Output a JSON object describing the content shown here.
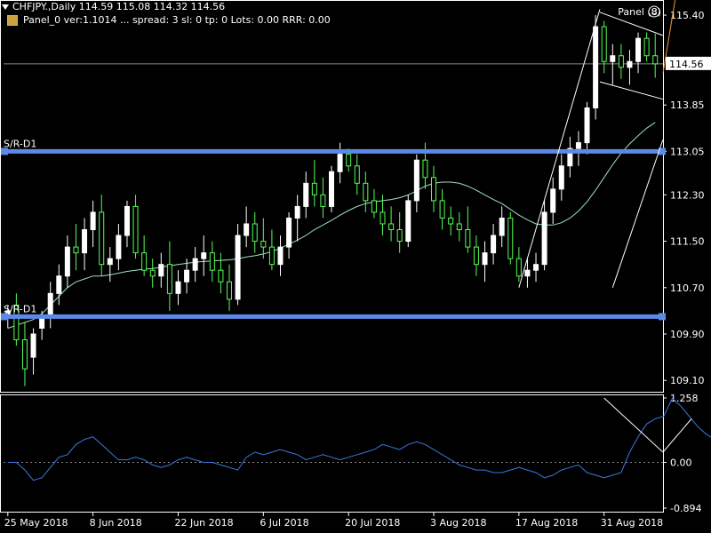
{
  "header": {
    "symbol_line": "CHFJPY.,Daily  114.59 115.08 114.32 114.56",
    "panel_line": "Panel_0 ver:1.1014 ... spread: 3   sl: 0   tp: 0   Lots: 0.00   RRR: 0.00",
    "panel_button": "Panel (8)"
  },
  "labels": {
    "sr_upper": "S/R-D1",
    "sr_lower": "S/R-D1"
  },
  "colors": {
    "background": "#000000",
    "bull": "#ffffff",
    "bear": "#55ff55",
    "sr_line": "#5b8ae8",
    "ma_line": "#9fe0c4",
    "oscillator": "#3b78e0",
    "trend_line": "#ffffff",
    "orange_line": "#f0a030",
    "price_tag_bg": "#ffffff",
    "price_tag_text": "#000000"
  },
  "chart_data": [
    {
      "type": "candlestick",
      "x_labels": [
        "25 May 2018",
        "8 Jun 2018",
        "22 Jun 2018",
        "6 Jul 2018",
        "20 Jul 2018",
        "3 Aug 2018",
        "17 Aug 2018",
        "31 Aug 2018"
      ],
      "y_ticks": [
        "115.40",
        "114.56",
        "113.85",
        "113.05",
        "112.30",
        "111.50",
        "110.70",
        "109.90",
        "109.10"
      ],
      "y_tick_values": [
        115.4,
        114.56,
        113.85,
        113.05,
        112.3,
        111.5,
        110.7,
        109.9,
        109.1
      ],
      "ylim": [
        108.95,
        115.6
      ],
      "current_price": "114.56",
      "support_resistance": [
        113.05,
        110.2
      ],
      "candles": [
        [
          110.2,
          110.4,
          110.0,
          110.3
        ],
        [
          110.4,
          110.6,
          109.7,
          109.8
        ],
        [
          109.8,
          110.1,
          109.0,
          109.3
        ],
        [
          109.5,
          110.0,
          109.2,
          109.9
        ],
        [
          110.0,
          110.3,
          109.8,
          110.2
        ],
        [
          110.2,
          110.8,
          110.0,
          110.6
        ],
        [
          110.6,
          111.1,
          110.4,
          110.9
        ],
        [
          110.9,
          111.6,
          110.7,
          111.4
        ],
        [
          111.4,
          111.8,
          111.0,
          111.3
        ],
        [
          111.3,
          111.9,
          111.0,
          111.7
        ],
        [
          111.7,
          112.2,
          111.4,
          112.0
        ],
        [
          112.0,
          112.3,
          110.9,
          111.1
        ],
        [
          111.1,
          111.4,
          110.8,
          111.2
        ],
        [
          111.2,
          111.8,
          111.0,
          111.6
        ],
        [
          111.6,
          112.2,
          111.4,
          112.1
        ],
        [
          112.1,
          112.3,
          111.2,
          111.3
        ],
        [
          111.3,
          111.6,
          110.9,
          111.0
        ],
        [
          111.0,
          111.2,
          110.7,
          110.9
        ],
        [
          110.9,
          111.3,
          110.7,
          111.1
        ],
        [
          111.1,
          111.5,
          110.3,
          110.6
        ],
        [
          110.6,
          111.0,
          110.4,
          110.8
        ],
        [
          110.8,
          111.2,
          110.6,
          111.0
        ],
        [
          111.0,
          111.4,
          110.8,
          111.2
        ],
        [
          111.2,
          111.6,
          110.9,
          111.3
        ],
        [
          111.3,
          111.5,
          110.8,
          111.0
        ],
        [
          111.0,
          111.3,
          110.6,
          110.8
        ],
        [
          110.8,
          111.1,
          110.3,
          110.5
        ],
        [
          110.5,
          111.8,
          110.4,
          111.6
        ],
        [
          111.6,
          112.1,
          111.4,
          111.8
        ],
        [
          111.8,
          112.0,
          111.3,
          111.5
        ],
        [
          111.5,
          111.9,
          111.2,
          111.4
        ],
        [
          111.4,
          111.7,
          111.0,
          111.1
        ],
        [
          111.1,
          111.6,
          110.9,
          111.4
        ],
        [
          111.4,
          112.0,
          111.2,
          111.9
        ],
        [
          111.9,
          112.3,
          111.5,
          112.1
        ],
        [
          112.1,
          112.7,
          111.9,
          112.5
        ],
        [
          112.5,
          112.9,
          112.1,
          112.3
        ],
        [
          112.3,
          112.6,
          111.9,
          112.1
        ],
        [
          112.1,
          112.8,
          112.0,
          112.7
        ],
        [
          112.7,
          113.2,
          112.5,
          113.0
        ],
        [
          113.0,
          113.1,
          112.7,
          112.8
        ],
        [
          112.8,
          113.0,
          112.3,
          112.5
        ],
        [
          112.5,
          112.7,
          112.0,
          112.2
        ],
        [
          112.2,
          112.4,
          111.9,
          112.0
        ],
        [
          112.0,
          112.3,
          111.6,
          111.8
        ],
        [
          111.8,
          112.1,
          111.5,
          111.7
        ],
        [
          111.7,
          112.0,
          111.3,
          111.5
        ],
        [
          111.5,
          112.3,
          111.4,
          112.2
        ],
        [
          112.2,
          113.0,
          112.0,
          112.9
        ],
        [
          112.9,
          113.2,
          112.4,
          112.6
        ],
        [
          112.6,
          112.8,
          112.0,
          112.2
        ],
        [
          112.2,
          112.4,
          111.7,
          111.9
        ],
        [
          111.9,
          112.1,
          111.6,
          111.8
        ],
        [
          111.8,
          112.0,
          111.5,
          111.7
        ],
        [
          111.7,
          112.1,
          111.3,
          111.4
        ],
        [
          111.4,
          111.6,
          110.9,
          111.1
        ],
        [
          111.1,
          111.5,
          110.8,
          111.3
        ],
        [
          111.3,
          111.8,
          111.1,
          111.6
        ],
        [
          111.6,
          112.1,
          111.4,
          111.9
        ],
        [
          111.9,
          112.0,
          111.1,
          111.2
        ],
        [
          111.2,
          111.4,
          110.8,
          110.9
        ],
        [
          110.9,
          111.2,
          110.7,
          111.0
        ],
        [
          111.0,
          111.3,
          110.8,
          111.1
        ],
        [
          111.1,
          112.2,
          111.0,
          112.0
        ],
        [
          112.0,
          112.6,
          111.8,
          112.4
        ],
        [
          112.4,
          113.0,
          112.2,
          112.8
        ],
        [
          112.8,
          113.3,
          112.6,
          113.1
        ],
        [
          113.1,
          113.4,
          112.8,
          113.2
        ],
        [
          113.2,
          113.9,
          113.0,
          113.8
        ],
        [
          113.8,
          115.4,
          113.6,
          115.2
        ],
        [
          115.2,
          115.3,
          114.4,
          114.6
        ],
        [
          114.6,
          114.9,
          114.2,
          114.7
        ],
        [
          114.7,
          114.9,
          114.3,
          114.5
        ],
        [
          114.5,
          114.8,
          114.2,
          114.6
        ],
        [
          114.6,
          115.1,
          114.4,
          115.0
        ],
        [
          115.0,
          115.1,
          114.6,
          114.7
        ],
        [
          114.7,
          115.08,
          114.32,
          114.56
        ]
      ],
      "moving_average": [
        110.0,
        110.05,
        110.1,
        110.15,
        110.25,
        110.4,
        110.55,
        110.7,
        110.8,
        110.85,
        110.9,
        110.9,
        110.92,
        110.95,
        110.98,
        111.0,
        111.02,
        111.03,
        111.05,
        111.08,
        111.1,
        111.12,
        111.14,
        111.15,
        111.16,
        111.17,
        111.18,
        111.2,
        111.23,
        111.25,
        111.28,
        111.32,
        111.38,
        111.45,
        111.52,
        111.6,
        111.7,
        111.78,
        111.86,
        111.95,
        112.03,
        112.1,
        112.15,
        112.18,
        112.2,
        112.22,
        112.25,
        112.3,
        112.37,
        112.45,
        112.5,
        112.52,
        112.52,
        112.5,
        112.45,
        112.38,
        112.3,
        112.22,
        112.15,
        112.05,
        111.95,
        111.87,
        111.8,
        111.78,
        111.78,
        111.82,
        111.9,
        112.02,
        112.18,
        112.38,
        112.6,
        112.82,
        113.02,
        113.18,
        113.32,
        113.45,
        113.55
      ]
    },
    {
      "type": "line",
      "title": "",
      "y_ticks": [
        "1.258",
        "0.00",
        "-0.894"
      ],
      "y_tick_values": [
        1.258,
        0.0,
        -0.894
      ],
      "ylim": [
        -0.894,
        1.258
      ],
      "values": [
        0.0,
        0.0,
        -0.15,
        -0.35,
        -0.3,
        -0.1,
        0.1,
        0.15,
        0.35,
        0.45,
        0.5,
        0.35,
        0.2,
        0.05,
        0.05,
        0.1,
        0.05,
        -0.05,
        -0.1,
        -0.05,
        0.05,
        0.1,
        0.05,
        0.0,
        0.0,
        -0.05,
        -0.1,
        -0.15,
        0.1,
        0.2,
        0.15,
        0.2,
        0.25,
        0.2,
        0.15,
        0.05,
        0.1,
        0.15,
        0.1,
        0.05,
        0.1,
        0.15,
        0.2,
        0.25,
        0.35,
        0.3,
        0.25,
        0.35,
        0.4,
        0.35,
        0.25,
        0.15,
        0.05,
        -0.05,
        -0.1,
        -0.15,
        -0.15,
        -0.2,
        -0.2,
        -0.15,
        -0.1,
        -0.15,
        -0.2,
        -0.3,
        -0.25,
        -0.15,
        -0.1,
        -0.05,
        -0.2,
        -0.25,
        -0.3,
        -0.25,
        -0.2,
        0.2,
        0.5,
        0.75,
        0.85,
        0.9,
        1.25,
        1.1,
        0.9,
        0.7,
        0.55,
        0.45,
        0.35,
        0.3
      ]
    }
  ]
}
